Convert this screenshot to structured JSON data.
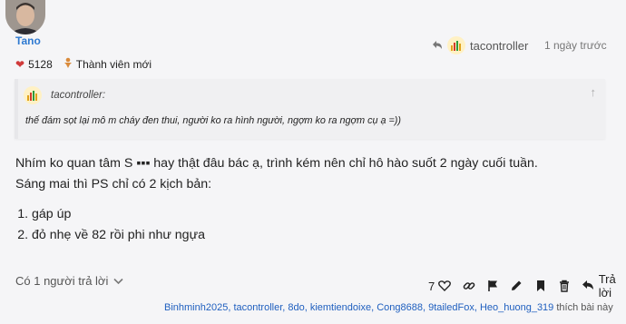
{
  "post": {
    "author": "Tano",
    "reply_to": "tacontroller",
    "time": "1 ngày trước",
    "likes": "5128",
    "badge": "Thành viên mới"
  },
  "quote": {
    "author": "tacontroller:",
    "text": "thế đám sọt lại mô m cháy đen thui, người ko ra hình người, ngợm ko ra ngợm cụ ạ =))"
  },
  "body": {
    "line1": "Nhím ko quan tâm S ▪▪▪ hay thật đâu bác ạ, trình kém nên chỉ hô hào suốt 2 ngày cuối tuần.",
    "line2": "Sáng mai thì PS chỉ có 2 kịch bản:",
    "items": [
      "gáp úp",
      "đỏ nhẹ về 82 rồi phi như ngựa"
    ]
  },
  "footer": {
    "replies": "Có 1 người trả lời",
    "like_count": "7",
    "reply_label": "Trả lời"
  },
  "liked_by": {
    "users": "Binhminh2025, tacontroller, 8do, kiemtiendoixe, Cong8688, 9tailedFox, Heo_huong_319",
    "suffix": " thích bài này"
  }
}
